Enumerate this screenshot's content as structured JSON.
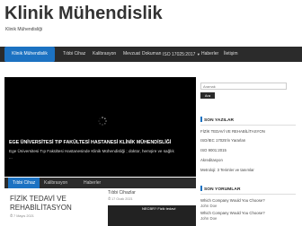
{
  "site": {
    "title": "Klinik Mühendislik",
    "tagline": "Klinik Mühendisliği"
  },
  "nav": [
    {
      "label": "Klinik Mühendislik",
      "active": true
    },
    {
      "label": "Tıbbi Cihaz"
    },
    {
      "label": "Kalibrasyon"
    },
    {
      "label": "Mevzuat"
    },
    {
      "label": "Dokuman"
    },
    {
      "label": "ISO 17025:2017",
      "dropdown": true
    },
    {
      "label": "Haberler"
    },
    {
      "label": "İletişim"
    }
  ],
  "slider": {
    "title": "EGE ÜNİVERSİTESİ TIP FAKÜLTESİ HASTANESİ KLİNİK MÜHENDİSLİĞİ",
    "excerpt": "Ege Üniversitesi Tıp Fakültesi Hastanesinde Klinik Mühendisliği ; doktor, hemşire ve sağlık",
    "excerpt_more": "..."
  },
  "tabs": [
    "Tıbbi Cihaz",
    "Kalibrasyon",
    "Haberler"
  ],
  "posts": [
    {
      "title": "FİZİK TEDAVİ VE REHABİLİTASYON",
      "date": "7 Mayıs 2021"
    },
    {
      "category": "Tıbbi Cihazlar",
      "date": "17 Ocak 2021",
      "thumb_text": "NECBR? Fizik tedavi"
    }
  ],
  "sidebar": {
    "search_placeholder": "Aramak",
    "search_button": "Ara",
    "recent_title": "SON YAZILAR",
    "recent": [
      "FİZİK TEDAVİ VE REHABİLİTASYON",
      "ISO/IEC 17025'in Yararları",
      "ISO 9001:2015",
      "Akreditasyon",
      "Metroloji: 3 Terimler ve tanımlar"
    ],
    "comments_title": "SON YORUMLAR",
    "comments": [
      {
        "text": "Which Company Would You Choose?",
        "author": "John Doe"
      },
      {
        "text": "Which Company Would You Choose?",
        "author": "John Doe"
      }
    ]
  },
  "colors": {
    "accent": "#1c72c2",
    "nav_bg": "#2b2b2b"
  }
}
